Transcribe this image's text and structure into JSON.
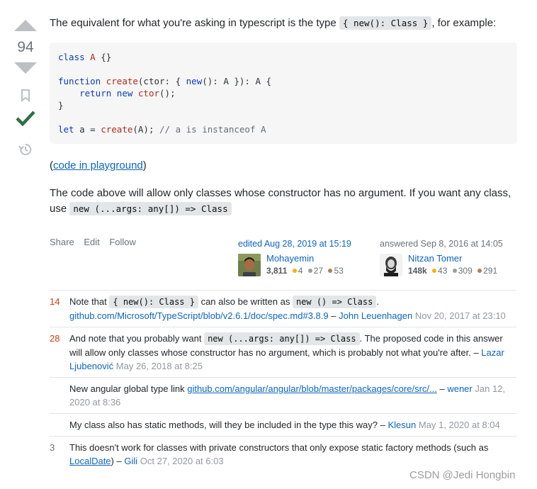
{
  "vote": {
    "score": "94"
  },
  "post": {
    "intro_before": "The equivalent for what you're asking in typescript is the type ",
    "intro_code": "{ new(): Class }",
    "intro_after": ", for example:",
    "code_lines": [
      "class A {}",
      "",
      "function create(ctor: { new(): A }): A {",
      "    return new ctor();",
      "}",
      "",
      "let a = create(A); // a is instanceof A"
    ],
    "playground_open": "(",
    "playground_link": "code in playground",
    "playground_close": ")",
    "para2_text": "The code above will allow only classes whose constructor has no argument. If you want any class, use ",
    "para2_code": "new (...args: any[]) => Class"
  },
  "menu": {
    "share": "Share",
    "edit": "Edit",
    "follow": "Follow"
  },
  "editor": {
    "action": "edited Aug 28, 2019 at 15:19",
    "name": "Mohayemin",
    "rep": "3,811",
    "gold": "4",
    "silver": "27",
    "bronze": "53"
  },
  "author": {
    "action": "answered Sep 8, 2016 at 14:05",
    "name": "Nitzan Tomer",
    "rep": "148k",
    "gold": "43",
    "silver": "309",
    "bronze": "291"
  },
  "comments": [
    {
      "score": "14",
      "t1": "Note that ",
      "c1": "{ new(): Class }",
      "t2": " can also be written as ",
      "c2": "new () => Class",
      "t3": ".",
      "link": "github.com/Microsoft/TypeScript/blob/v2.6.1/doc/spec.md#3.8.9",
      "sep": " – ",
      "user": "John Leuenhagen",
      "date": "Nov 20, 2017 at 23:10"
    },
    {
      "score": "28",
      "t1": "And note that you probably want ",
      "c1": "new (...args: any[]) => Class",
      "t2": ". The proposed code in this answer will allow only classes whose constructor has no argument, which is probably not what you're after.",
      "sep": " – ",
      "user": "Lazar Ljubenović",
      "date": "May 26, 2018 at 8:25"
    },
    {
      "score": "",
      "t1": "New angular global type link ",
      "link": "github.com/angular/angular/blob/master/packages/core/src/...",
      "sep": " – ",
      "user": "wener",
      "date": "Jan 12, 2020 at 8:36"
    },
    {
      "score": "",
      "t1": "My class also has static methods, will they be included in the type this way?",
      "sep": " – ",
      "user": "Klesun",
      "date": "May 1, 2020 at 8:04"
    },
    {
      "score": "3",
      "t1": "This doesn't work for classes with private constructors that only expose static factory methods (such as ",
      "link": "LocalDate",
      "t2": ")",
      "sep": " – ",
      "user": "Gili",
      "date": "Oct 27, 2020 at 6:03"
    }
  ],
  "watermark": "CSDN @Jedi Hongbin"
}
